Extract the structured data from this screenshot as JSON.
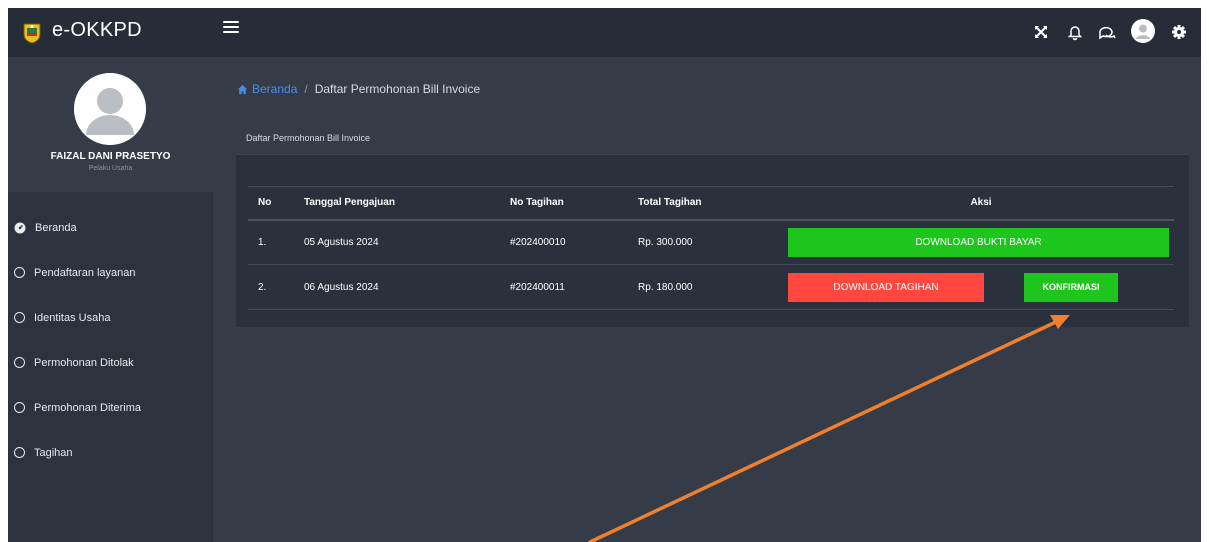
{
  "app": {
    "name": "e-OKKPD"
  },
  "user": {
    "name": "FAIZAL DANI PRASETYO",
    "role": "Pelaku Usaha"
  },
  "sidebar": {
    "items": [
      {
        "label": "Beranda",
        "icon": "dashboard-icon"
      },
      {
        "label": "Pendaftaran layanan",
        "icon": "circle-icon"
      },
      {
        "label": "Identitas Usaha",
        "icon": "circle-icon"
      },
      {
        "label": "Permohonan Ditolak",
        "icon": "circle-icon"
      },
      {
        "label": "Permohonan Diterima",
        "icon": "circle-icon"
      },
      {
        "label": "Tagihan",
        "icon": "circle-icon"
      }
    ]
  },
  "topbar": {
    "icons": [
      "fullscreen-icon",
      "bell-icon",
      "chat-icon",
      "user-avatar-icon",
      "gear-icon"
    ]
  },
  "breadcrumb": {
    "home": "Beranda",
    "separator": "/",
    "current": "Daftar Permohonan Bill Invoice"
  },
  "card": {
    "title": "Daftar Permohonan Bill Invoice"
  },
  "table": {
    "headers": {
      "no": "No",
      "date": "Tanggal Pengajuan",
      "invoice": "No Tagihan",
      "total": "Total Tagihan",
      "action": "Aksi"
    },
    "rows": [
      {
        "no": "1.",
        "date": "05 Agustus 2024",
        "invoice": "#202400010",
        "total": "Rp. 300.000",
        "action_primary": "DOWNLOAD BUKTI BAYAR"
      },
      {
        "no": "2.",
        "date": "06 Agustus 2024",
        "invoice": "#202400011",
        "total": "Rp. 180.000",
        "action_primary": "DOWNLOAD TAGIHAN",
        "action_secondary": "KONFIRMASI"
      }
    ]
  },
  "colors": {
    "topbar": "#272d38",
    "sidebar": "#2d333e",
    "content": "#353c48",
    "card": "#2b313c",
    "success": "#1ec51c",
    "danger": "#ff473f",
    "link": "#4a8ef0",
    "annotation_arrow": "#f08030"
  }
}
